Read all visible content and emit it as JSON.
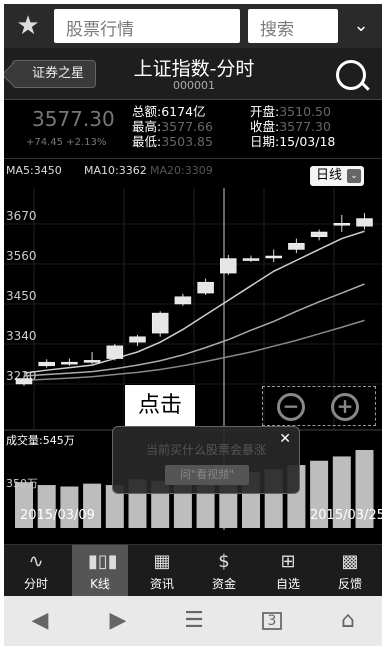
{
  "topbar": {
    "search_text": "股票行情",
    "search_button": "搜索"
  },
  "titlebar": {
    "back_label": "证券之星",
    "title": "上证指数-分时",
    "code": "000001"
  },
  "quote": {
    "price": "3577.30",
    "change": "+74.45 +2.13%",
    "total_label": "总额:",
    "total_value": "6174亿",
    "high_label": "最高:",
    "high_value": "3577.66",
    "low_label": "最低:",
    "low_value": "3503.85",
    "open_label": "开盘:",
    "open_value": "3510.50",
    "close_label": "收盘:",
    "close_value": "3577.30",
    "date_label": "日期:",
    "date_value": "15/03/18"
  },
  "chart": {
    "ma5": "MA5:3450",
    "ma10": "MA10:3362",
    "ma20": "MA20:3309",
    "period": "日线",
    "callout": "点击",
    "volume_label": "成交量:545万",
    "volume_tick": "350万",
    "date_start": "2015/03/09",
    "date_end": "2015/03/25"
  },
  "popup": {
    "text": "当前买什么股票会暴涨",
    "button": "问\"看视频\""
  },
  "tabs": [
    {
      "label": "分时",
      "icon": "timeshare-icon"
    },
    {
      "label": "K线",
      "icon": "kline-icon"
    },
    {
      "label": "资讯",
      "icon": "news-icon"
    },
    {
      "label": "资金",
      "icon": "money-icon"
    },
    {
      "label": "自选",
      "icon": "add-watchlist-icon"
    },
    {
      "label": "反馈",
      "icon": "feedback-icon"
    }
  ],
  "nav": {
    "recent_count": "3"
  },
  "chart_data": {
    "type": "candlestick",
    "y_ticks": [
      "3670",
      "3560",
      "3450",
      "3340",
      "3230"
    ],
    "candles": [
      {
        "open": 3245,
        "close": 3230,
        "high": 3252,
        "low": 3225
      },
      {
        "open": 3280,
        "close": 3290,
        "high": 3298,
        "low": 3275
      },
      {
        "open": 3285,
        "close": 3290,
        "high": 3300,
        "low": 3280
      },
      {
        "open": 3295,
        "close": 3290,
        "high": 3318,
        "low": 3285
      },
      {
        "open": 3300,
        "close": 3335,
        "high": 3340,
        "low": 3295
      },
      {
        "open": 3345,
        "close": 3360,
        "high": 3365,
        "low": 3335
      },
      {
        "open": 3370,
        "close": 3425,
        "high": 3430,
        "low": 3360
      },
      {
        "open": 3450,
        "close": 3470,
        "high": 3478,
        "low": 3445
      },
      {
        "open": 3480,
        "close": 3510,
        "high": 3520,
        "low": 3475
      },
      {
        "open": 3535,
        "close": 3575,
        "high": 3585,
        "low": 3530
      },
      {
        "open": 3575,
        "close": 3572,
        "high": 3583,
        "low": 3566
      },
      {
        "open": 3582,
        "close": 3580,
        "high": 3600,
        "low": 3565
      },
      {
        "open": 3600,
        "close": 3617,
        "high": 3630,
        "low": 3590
      },
      {
        "open": 3635,
        "close": 3648,
        "high": 3655,
        "low": 3625
      },
      {
        "open": 3672,
        "close": 3670,
        "high": 3695,
        "low": 3648
      },
      {
        "open": 3664,
        "close": 3685,
        "high": 3700,
        "low": 3655
      }
    ],
    "ma_lines": [
      {
        "name": "MA5",
        "values": [
          3260,
          3268,
          3275,
          3282,
          3300,
          3318,
          3345,
          3380,
          3420,
          3460,
          3500,
          3540,
          3570,
          3600,
          3630,
          3650
        ]
      },
      {
        "name": "MA10",
        "values": [
          3252,
          3256,
          3260,
          3264,
          3272,
          3282,
          3294,
          3310,
          3330,
          3352,
          3378,
          3402,
          3430,
          3456,
          3480,
          3505
        ]
      },
      {
        "name": "MA20",
        "values": [
          3240,
          3243,
          3246,
          3250,
          3256,
          3262,
          3270,
          3280,
          3292,
          3305,
          3318,
          3334,
          3350,
          3368,
          3386,
          3405
        ]
      }
    ],
    "volumes": [
      320,
      300,
      290,
      310,
      300,
      340,
      330,
      350,
      340,
      360,
      390,
      410,
      440,
      470,
      500,
      545
    ]
  }
}
